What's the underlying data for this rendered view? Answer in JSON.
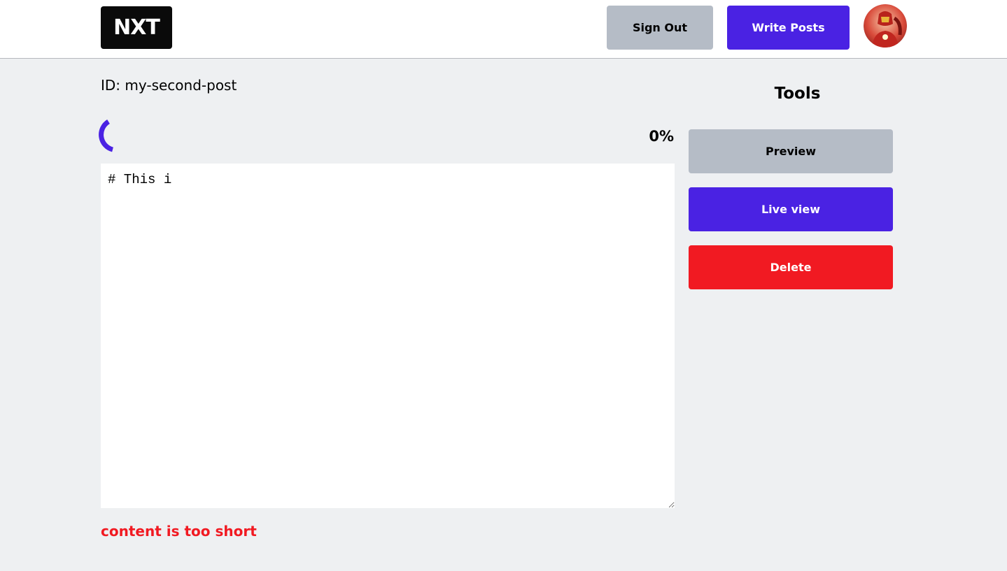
{
  "navbar": {
    "logo_text": "NXT",
    "signout_label": "Sign Out",
    "write_label": "Write Posts",
    "avatar_icon": "user-avatar-icon"
  },
  "editor": {
    "post_id": "ID: my-second-post",
    "progress_text": "0%",
    "content": "# This i",
    "error": "content is too short"
  },
  "tools": {
    "title": "Tools",
    "preview_label": "Preview",
    "live_label": "Live view",
    "delete_label": "Delete"
  },
  "colors": {
    "accent": "#4a22e3",
    "danger": "#f11a22",
    "neutral": "#b5bcc6",
    "background": "#eef0f2"
  }
}
